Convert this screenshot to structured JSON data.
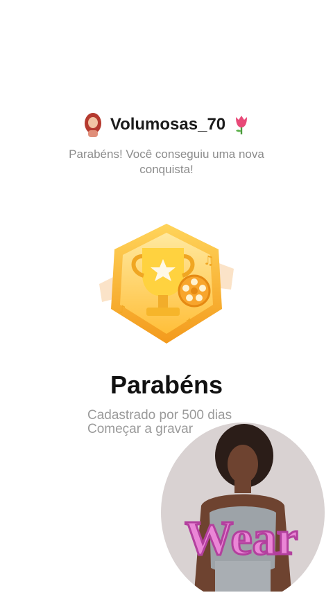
{
  "header": {
    "username": "Volumosas_70",
    "avatar_icon": "woman-avatar-icon",
    "flower_icon": "tulip-icon"
  },
  "message": {
    "subtitle": "Parabéns! Você conseguiu uma nova conquista!"
  },
  "achievement": {
    "badge_icon": "trophy-film-reel-badge-icon",
    "title": "Parabéns",
    "line1": "Cadastrado por 500 dias",
    "line2": "Começar a gravar"
  },
  "overlay": {
    "sticker_text": "Wear",
    "photo": "woman-portrait-photo"
  },
  "colors": {
    "gold": "#f6b52a",
    "pink": "#e87ad0"
  }
}
